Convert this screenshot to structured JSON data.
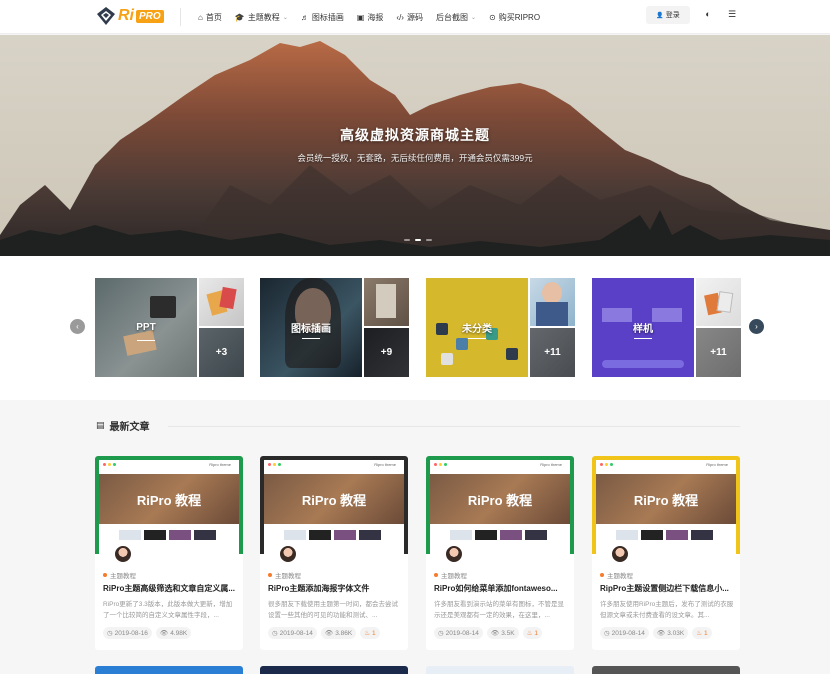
{
  "header": {
    "logo_ri": "Ri",
    "logo_pro": "PRO",
    "nav": [
      {
        "icon": "⌂",
        "label": "首页",
        "caret": ""
      },
      {
        "icon": "🎓",
        "label": "主题教程",
        "caret": "⌄"
      },
      {
        "icon": "♬",
        "label": "图标插画",
        "caret": ""
      },
      {
        "icon": "▣",
        "label": "海报",
        "caret": ""
      },
      {
        "icon": "‹/›",
        "label": "源码",
        "caret": ""
      },
      {
        "icon": "",
        "label": "后台截图",
        "caret": "⌄"
      },
      {
        "icon": "⊙",
        "label": "购买RIPRO",
        "caret": ""
      }
    ],
    "login_label": "登录",
    "login_icon": "👤",
    "theme_icon": "◐",
    "menu_icon": "☰",
    "brand_color": "#f7a114"
  },
  "hero": {
    "title": "高级虚拟资源商城主题",
    "subtitle": "会员统一授权，无套路，无后续任何费用，开通会员仅需399元"
  },
  "categories": [
    {
      "label": "PPT",
      "more": "+3"
    },
    {
      "label": "图标插画",
      "more": "+9"
    },
    {
      "label": "未分类",
      "more": "+11"
    },
    {
      "label": "样机",
      "more": "+11"
    }
  ],
  "latest": {
    "title": "最新文章",
    "icon": "▤",
    "cards": [
      {
        "thumb_text": "RiPro 教程",
        "thumb_brand": "Ripro theme",
        "category": "主题教程",
        "title": "RiPro主题高级筛选和文章自定义属...",
        "excerpt": "RiPro更新了3.3版本，此版本做大更新，增加了一个比较简的自定义文章属性字段，...",
        "date": "2019-08-16",
        "views": "4.98K",
        "likes": ""
      },
      {
        "thumb_text": "RiPro 教程",
        "thumb_brand": "Ripro theme",
        "category": "主题教程",
        "title": "RiPro主题添加海报字体文件",
        "excerpt": "很多朋友下载使用主题第一时间，都会去尝试设置一些其他的可见的功能和测试、...",
        "date": "2019-08-14",
        "views": "3.86K",
        "likes": "1"
      },
      {
        "thumb_text": "RiPro 教程",
        "thumb_brand": "Ripro theme",
        "category": "主题教程",
        "title": "RiPro如何给菜单添加fontaweso...",
        "excerpt": "许多朋友看到演示站的菜单有图标，不管是显示还是美观都有一定的效果，在这里，...",
        "date": "2019-08-14",
        "views": "3.5K",
        "likes": "1"
      },
      {
        "thumb_text": "RiPro 教程",
        "thumb_brand": "Ripro theme",
        "category": "主题教程",
        "title": "RipPro主题设置侧边栏下载信息小...",
        "excerpt": "许多朋友使用RiPro主题后，发布了测试的衣服但源文章或未付费查看的设文章。其...",
        "date": "2019-08-14",
        "views": "3.03K",
        "likes": "1"
      }
    ]
  }
}
